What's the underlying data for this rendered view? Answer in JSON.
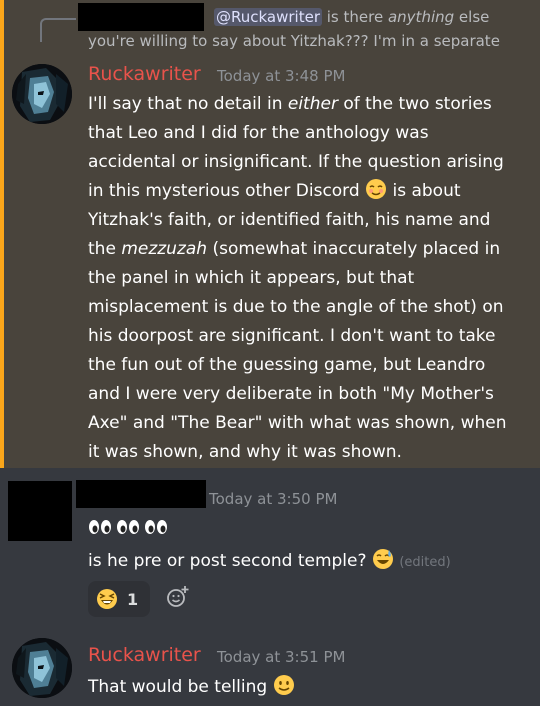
{
  "reply": {
    "mention": "@Ruckawriter",
    "pre_italic": " is there ",
    "italic": "anything",
    "post_italic": " else",
    "line2": "you're willing to say about Yitzhak??? I'm in a separate"
  },
  "messages": [
    {
      "author": "Ruckawriter",
      "timestamp": "Today at 3:48 PM",
      "p1": "I'll say that no detail in ",
      "p1_em": "either",
      "p2": " of the two stories that Leo and I did for the anthology was accidental or insignificant. If the question arising in this mysterious other Discord ",
      "p3": " is about Yitzhak's faith, or identified faith, his name and the ",
      "p3_em": "mezzuzah",
      "p4": " (somewhat inaccurately placed in the panel in which it appears, but that misplacement is due to the angle of the shot) on his doorpost are significant. I don't want to take the fun out of the guessing game, but Leandro and I were very deliberate in both \"My Mother's Axe\" and \"The Bear\" with what was shown, when it was shown, and why it was shown."
    },
    {
      "author": "",
      "timestamp": "Today at 3:50 PM",
      "line2": "is he pre or post second temple?",
      "edited": "(edited)",
      "reaction_count": "1"
    },
    {
      "author": "Ruckawriter",
      "timestamp": "Today at 3:51 PM",
      "text": "That would be telling"
    }
  ],
  "colors": {
    "background": "#36393f",
    "highlight_bg": "#49443c",
    "highlight_border": "#faa61a",
    "username": "#e9534b",
    "timestamp": "#8e9297",
    "mention": "#dee0fc"
  }
}
